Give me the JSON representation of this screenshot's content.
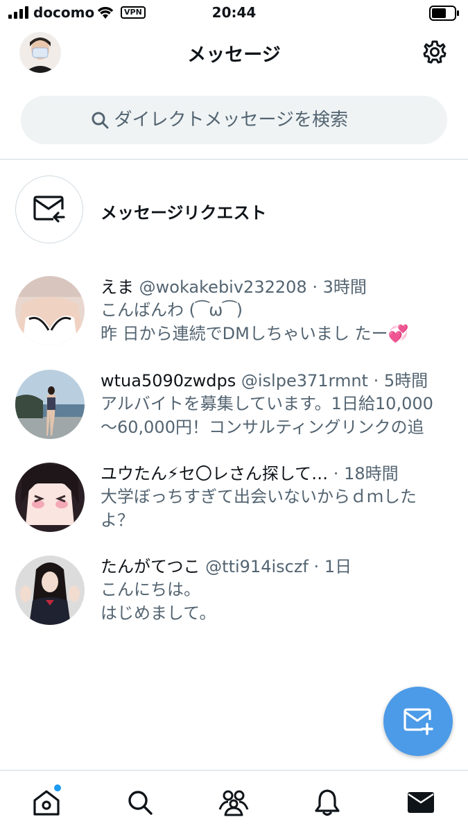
{
  "status_bar": {
    "carrier": "docomo",
    "vpn": "VPN",
    "time": "20:44"
  },
  "header": {
    "title": "メッセージ"
  },
  "search": {
    "placeholder": "ダイレクトメッセージを検索"
  },
  "message_request": {
    "label": "メッセージリクエスト"
  },
  "conversations": [
    {
      "name": "えま",
      "handle": "@wokakebiv232208",
      "time": "3時間",
      "preview_line1": "こんばんわ (⁀ω⁀)",
      "preview_line2": "昨 日から連続でDMしちゃいまし たー💞"
    },
    {
      "name": "wtua5090zwdps",
      "handle": "@islpe371rmnt",
      "time": "5時間",
      "preview_line1": "アルバイトを募集しています。1日給10,000",
      "preview_line2": "〜60,000円！コンサルティングリンクの追"
    },
    {
      "name": "ユウたん⚡セ〇レさん探して…",
      "handle": "",
      "time": "18時間",
      "preview_line1": "大学ぼっちすぎて出会いないからｄｍした",
      "preview_line2": "よ？"
    },
    {
      "name": "たんがてつこ",
      "handle": "@tti914isczf",
      "time": "1日",
      "preview_line1": "こんにちは。",
      "preview_line2": "はじめまして。"
    }
  ],
  "separator": "·",
  "colors": {
    "accent": "#1d9bf0",
    "fab": "#4c9be8",
    "secondary_text": "#536471"
  },
  "icons": {
    "tabs": [
      "home-icon",
      "search-icon",
      "communities-icon",
      "bell-icon",
      "mail-icon"
    ]
  }
}
